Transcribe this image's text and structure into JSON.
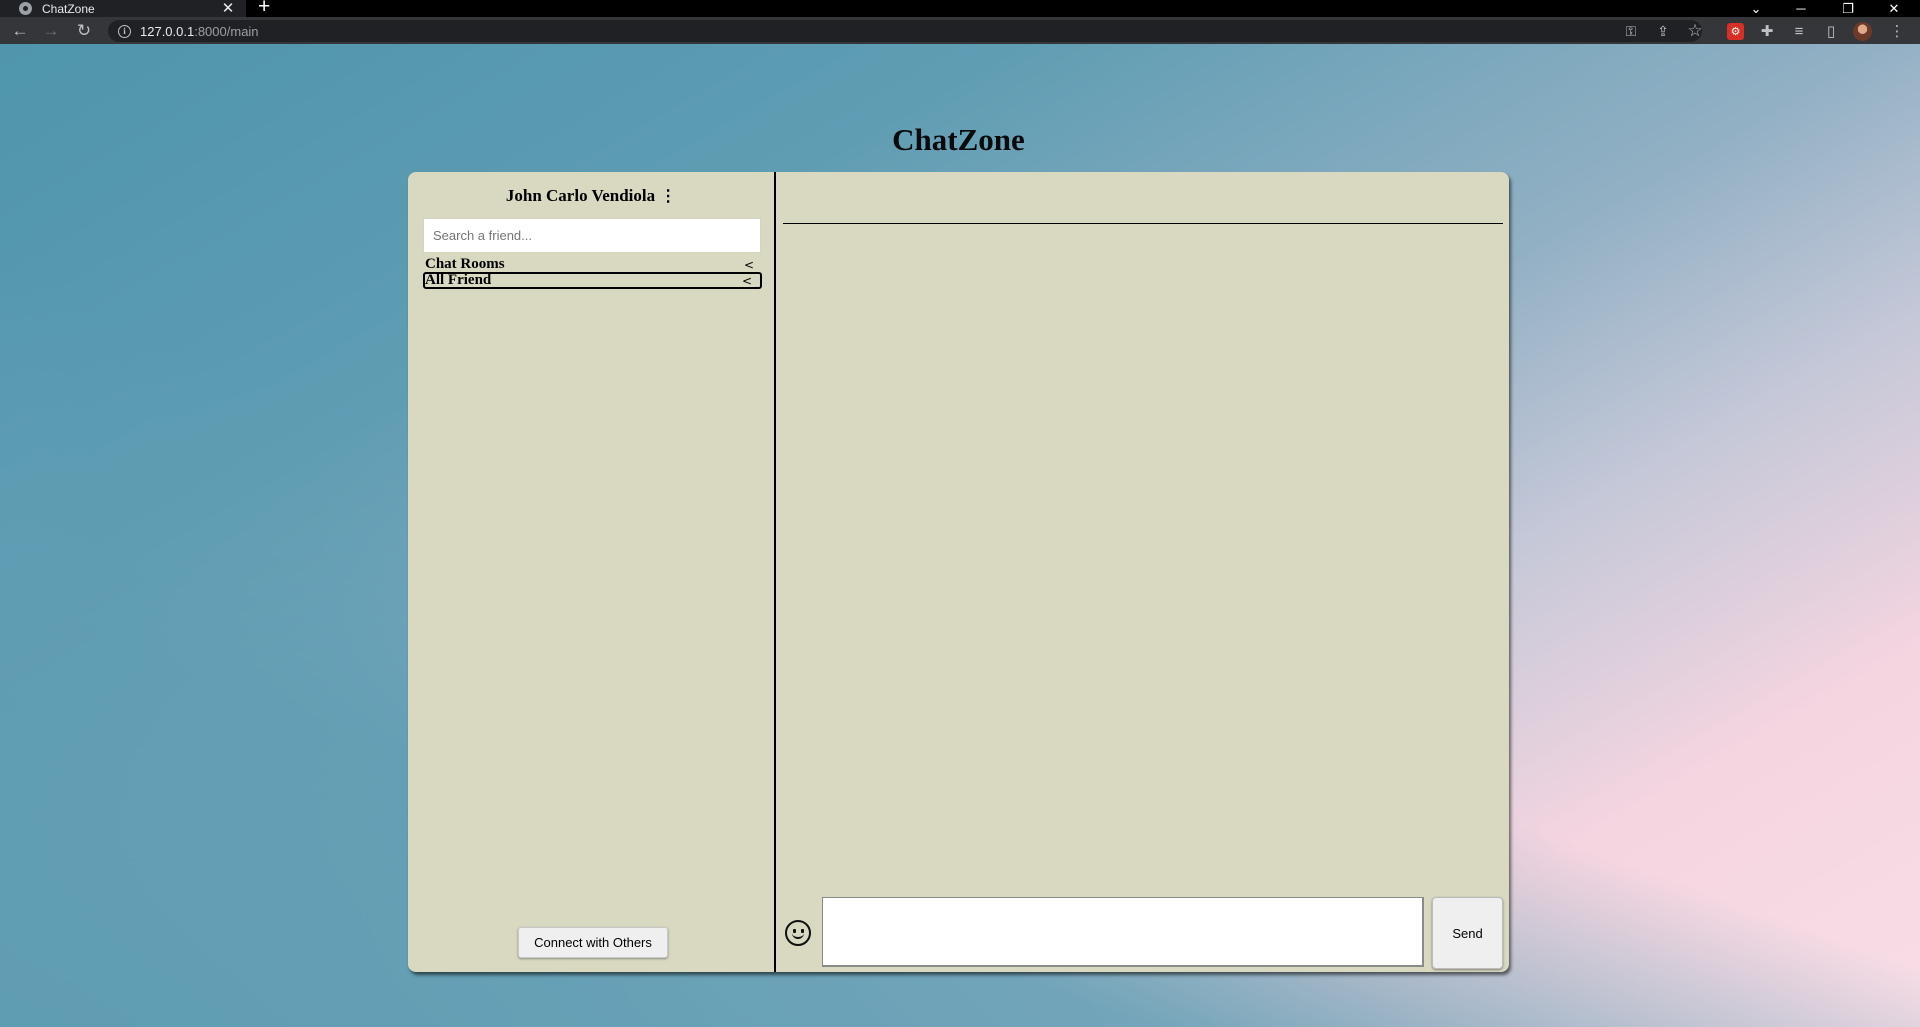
{
  "browser": {
    "tab_title": "ChatZone",
    "tab_close": "✕",
    "new_tab": "+",
    "url_host": "127.0.0.1",
    "url_rest": ":8000/main",
    "icons": [
      "back-icon",
      "forward-icon",
      "reload-icon",
      "info-icon",
      "key-icon",
      "share-icon",
      "star-icon",
      "extension-icon",
      "puzzle-icon",
      "media-icon",
      "sidebar-icon",
      "profile-avatar",
      "menu-icon"
    ]
  },
  "app": {
    "title": "ChatZone",
    "user_name": "John Carlo Vendiola",
    "menu_icon": "⋮",
    "search_placeholder": "Search a friend...",
    "nav": [
      {
        "label": "Chat Rooms",
        "chevron": "<"
      },
      {
        "label": "All Friend",
        "chevron": "<"
      }
    ],
    "connect_label": "Connect with Others",
    "send_label": "Send"
  },
  "colors": {
    "panel": "#d9d8c1",
    "chrome_dark": "#35363a",
    "tabbar": "#000000"
  }
}
